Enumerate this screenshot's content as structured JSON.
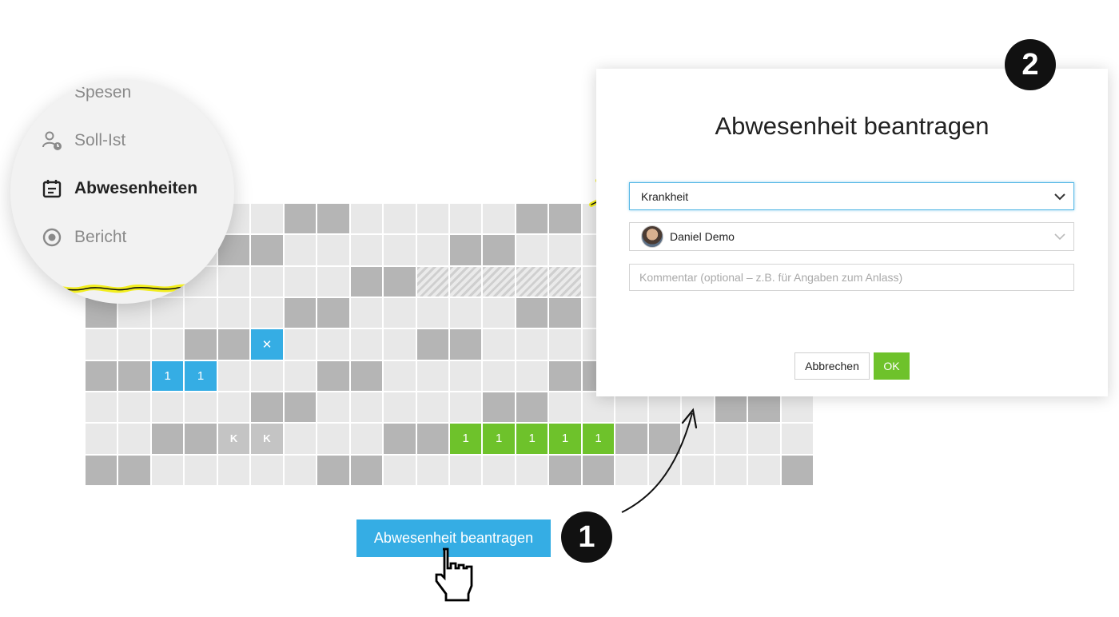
{
  "sidebar": {
    "items": [
      {
        "label": "Spesen",
        "icon": "receipt-icon"
      },
      {
        "label": "Soll-Ist",
        "icon": "user-clock-icon"
      },
      {
        "label": "Abwesenheiten",
        "icon": "calendar-icon",
        "active": true
      },
      {
        "label": "Bericht",
        "icon": "eye-icon"
      }
    ]
  },
  "calendar": {
    "marks": {
      "vacation": "1",
      "sick": "K",
      "cancelled": "✕"
    }
  },
  "dialog": {
    "title": "Abwesenheit beantragen",
    "type_value": "Krankheit",
    "person_value": "Daniel Demo",
    "comment_placeholder": "Kommentar (optional – z.B. für Angaben zum Anlass)",
    "cancel_label": "Abbrechen",
    "ok_label": "OK"
  },
  "request_button": {
    "label": "Abwesenheit beantragen"
  },
  "steps": {
    "one": "1",
    "two": "2"
  },
  "colors": {
    "accent_blue": "#35ade4",
    "accent_green": "#6ec22b",
    "highlight_yellow": "#f2ee1f"
  }
}
